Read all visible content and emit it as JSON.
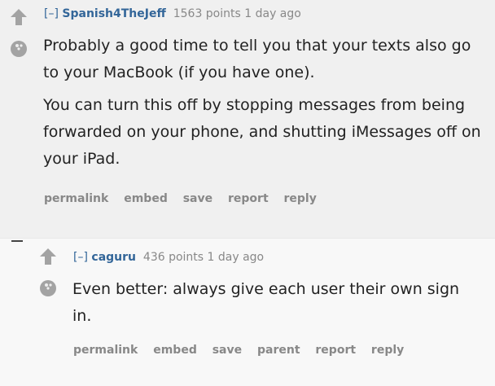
{
  "comments": [
    {
      "expand_label": "[–]",
      "author": "Spanish4TheJeff",
      "score": "1563 points",
      "age": "1 day ago",
      "paragraphs": [
        "Probably a good time to tell you that your texts also go to your MacBook (if you have one).",
        "You can turn this off by stopping messages from being forwarded on your phone, and shutting iMessages off on your iPad."
      ],
      "buttons": [
        "permalink",
        "embed",
        "save",
        "report",
        "reply"
      ]
    },
    {
      "expand_label": "[–]",
      "author": "caguru",
      "score": "436 points",
      "age": "1 day ago",
      "paragraphs": [
        "Even better: always give each user their own sign in."
      ],
      "buttons": [
        "permalink",
        "embed",
        "save",
        "parent",
        "report",
        "reply"
      ]
    }
  ],
  "colors": {
    "author": "#336699",
    "meta": "#888888",
    "text": "#222222",
    "arrow": "#a3a3a3",
    "background": "#f0f0f0",
    "child_background": "#f8f8f8"
  },
  "icons": {
    "upvote": "upvote-arrow-icon",
    "downvote": "downvote-ball-icon"
  }
}
